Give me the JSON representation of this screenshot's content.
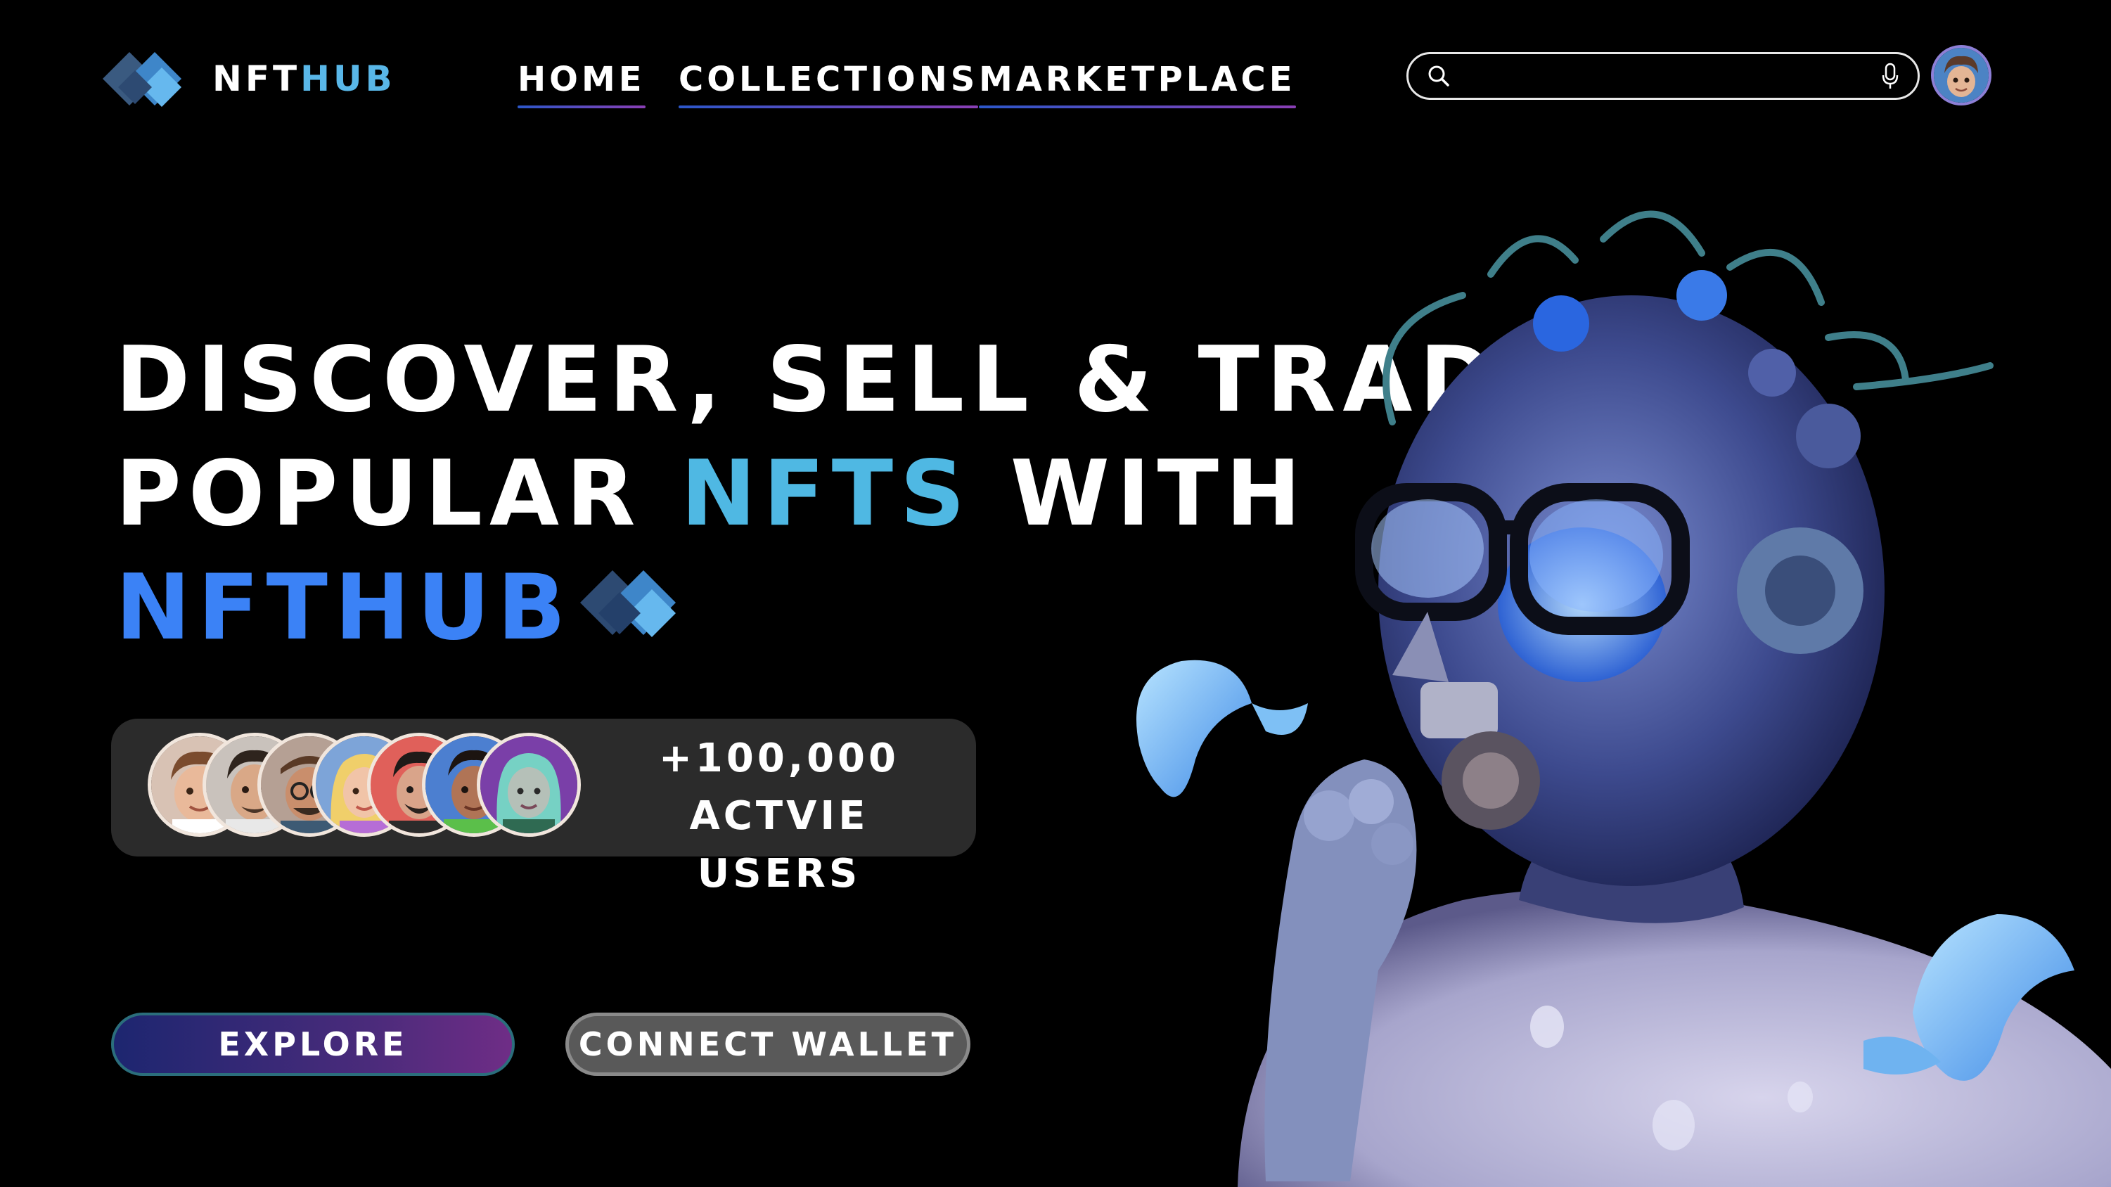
{
  "header": {
    "logo": {
      "part1": "NFT",
      "part2": "HUB"
    },
    "nav": [
      {
        "label": "HOME"
      },
      {
        "label": "COLLECTIONS"
      },
      {
        "label": "MARKETPLACE"
      }
    ],
    "search": {
      "value": "",
      "placeholder": ""
    },
    "icons": {
      "search": "search-icon",
      "mic": "microphone-icon",
      "avatar": "user-avatar"
    }
  },
  "hero": {
    "line1": "DISCOVER, SELL & TRADE",
    "line2_start": "POPULAR ",
    "line2_accent": "NFTS",
    "line2_end": " WITH",
    "line3": "NFTHUB",
    "users": {
      "count": "+100,000",
      "label": "ACTVIE USERS",
      "avatar_count": 7
    },
    "buttons": {
      "explore": "EXPLORE",
      "connect_wallet": "CONNECT WALLET"
    },
    "art": "3d-sculpted-head-with-glasses-and-fish"
  },
  "colors": {
    "background": "#000000",
    "accent_light_blue": "#4fb8e3",
    "accent_blue": "#3b82f6",
    "card_bg": "#2b2b2b",
    "explore_gradient_start": "#1d2670",
    "explore_gradient_end": "#6f2d86",
    "wallet_bg": "#595959"
  }
}
